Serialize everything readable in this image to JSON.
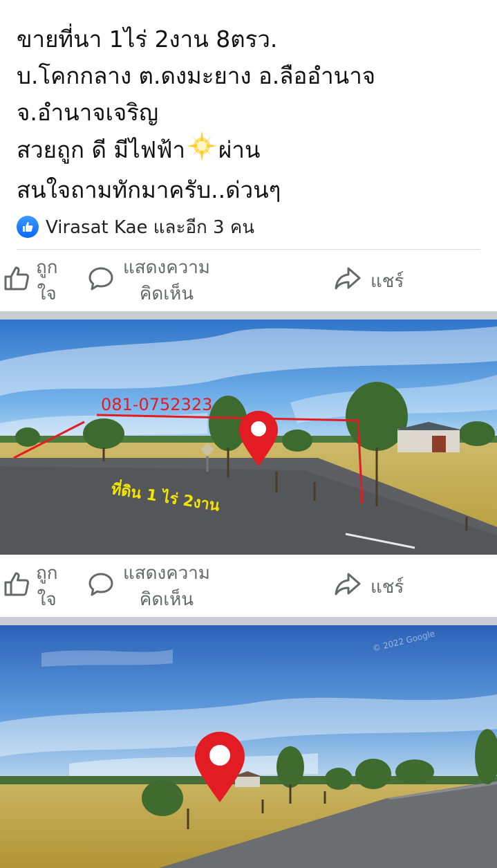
{
  "post": {
    "lines": [
      "ขายที่นา  1ไร่ 2งาน 8ตรว.",
      "บ.โคกกลาง ต.ดงมะยาง อ.ลืออำนาจ",
      "จ.อำนาจเจริญ",
      "สวยถูก ดี มีไฟฟ้า",
      "ผ่าน",
      "สนใจถามทักมาครับ..ด่วนๆ"
    ]
  },
  "reactions": {
    "text": "Virasat Kae และอีก 3 คน",
    "icon": "thumbs-up-badge-icon",
    "color": "#0866ff"
  },
  "actions": {
    "like_line1": "ถูก",
    "like_line2": "ใจ",
    "comment_line1": "แสดงความ",
    "comment_line2": "คิดเห็น",
    "share": "แชร์"
  },
  "photo1": {
    "phone": "081-0752323",
    "land_label": "ที่ดิน 1 ไร่ 2งาน"
  },
  "photo2": {
    "watermark": "© 2022 Google"
  }
}
